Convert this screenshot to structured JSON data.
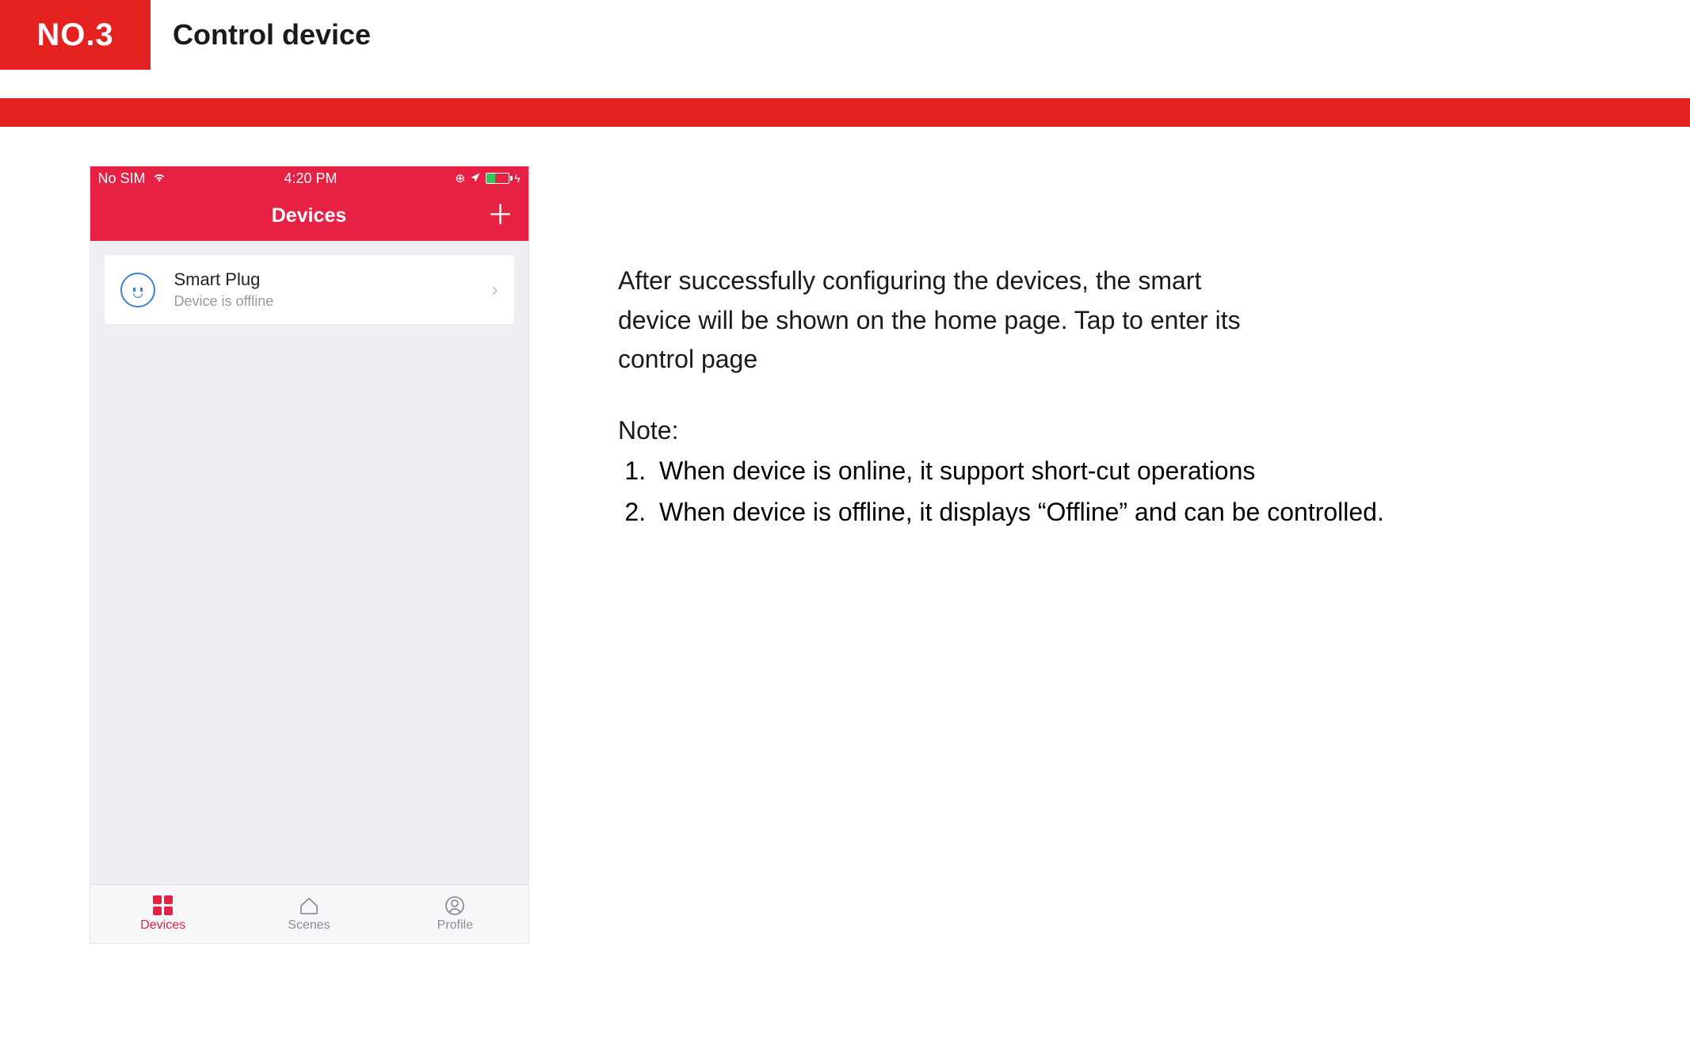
{
  "header": {
    "badge": "NO.3",
    "title": "Control device"
  },
  "phone": {
    "status": {
      "carrier": "No SIM",
      "time": "4:20 PM"
    },
    "nav": {
      "title": "Devices",
      "add_symbol": "＋"
    },
    "device": {
      "name": "Smart Plug",
      "status": "Device is offline",
      "chevron": "›"
    },
    "tabs": {
      "devices": "Devices",
      "scenes": "Scenes",
      "profile": "Profile"
    }
  },
  "text": {
    "paragraph": "After successfully configuring the devices, the smart device will be shown on the home page. Tap to enter its control page",
    "note_label": "Note:",
    "note1": "When device is online, it support short-cut operations",
    "note2": "When device is offline, it displays “Offline” and can be controlled."
  }
}
